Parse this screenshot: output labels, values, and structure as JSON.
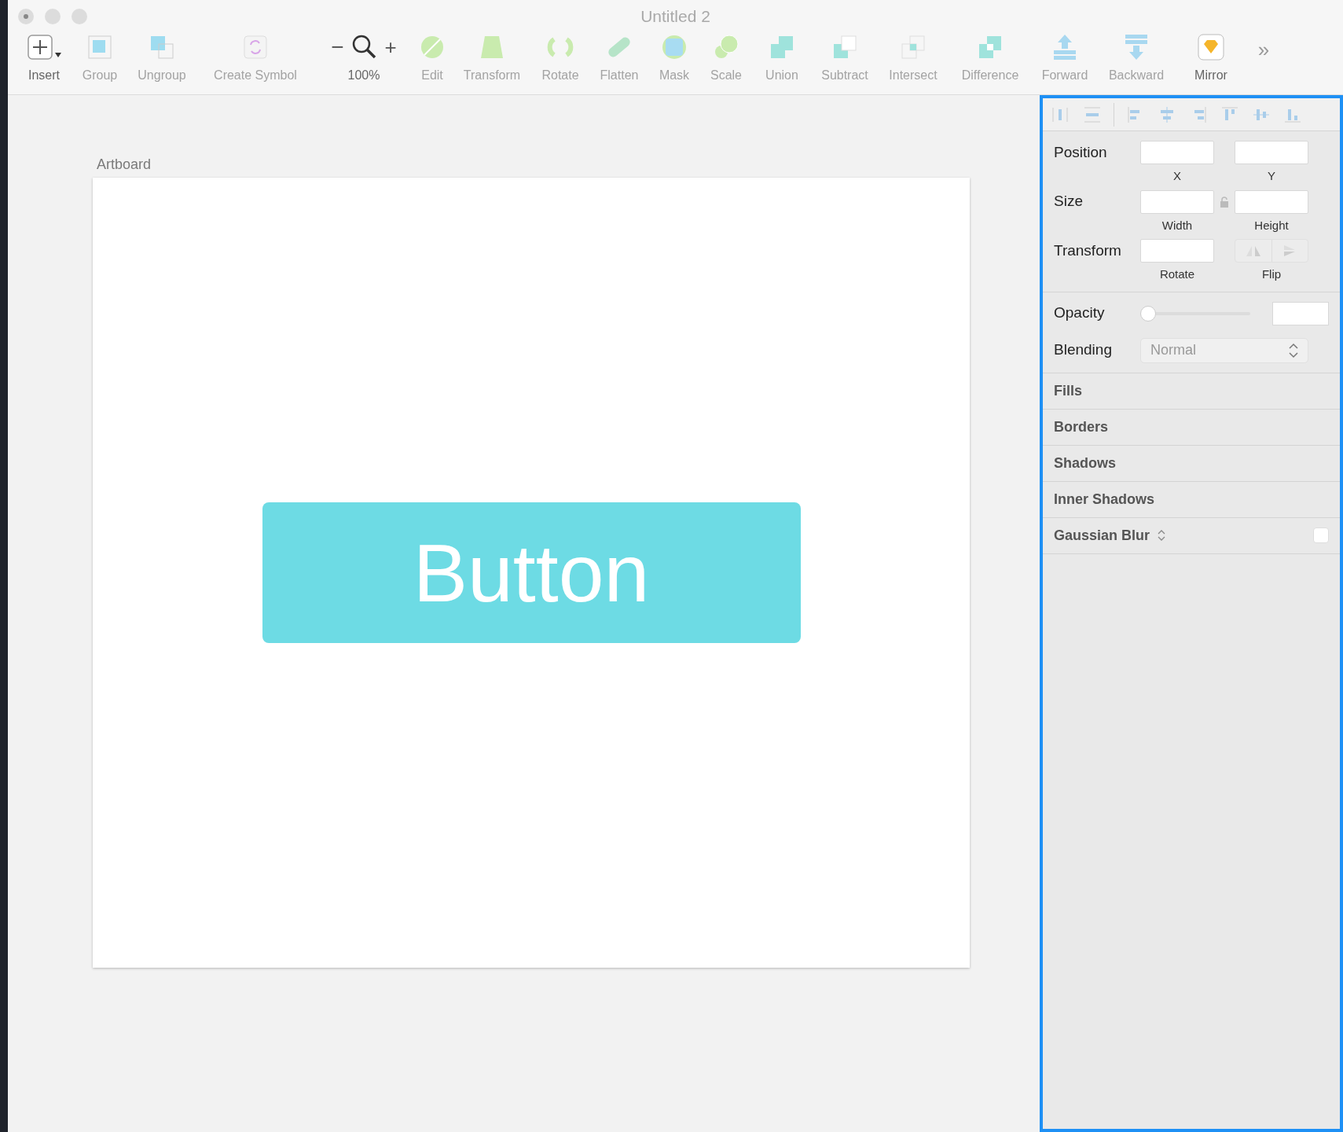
{
  "window": {
    "title": "Untitled 2"
  },
  "toolbar": [
    {
      "kind": "insert",
      "label": "Insert",
      "disabled": false
    },
    {
      "kind": "button",
      "label": "Group",
      "disabled": true
    },
    {
      "kind": "button",
      "label": "Ungroup",
      "disabled": true
    },
    {
      "kind": "button",
      "label": "Create Symbol",
      "disabled": true
    },
    {
      "kind": "zoom",
      "label": "100%",
      "minus": "−",
      "plus": "+"
    },
    {
      "kind": "button",
      "label": "Edit",
      "disabled": true
    },
    {
      "kind": "button",
      "label": "Transform",
      "disabled": true
    },
    {
      "kind": "button",
      "label": "Rotate",
      "disabled": true
    },
    {
      "kind": "button",
      "label": "Flatten",
      "disabled": true
    },
    {
      "kind": "button",
      "label": "Mask",
      "disabled": true
    },
    {
      "kind": "button",
      "label": "Scale",
      "disabled": true
    },
    {
      "kind": "button",
      "label": "Union",
      "disabled": true
    },
    {
      "kind": "button",
      "label": "Subtract",
      "disabled": true
    },
    {
      "kind": "button",
      "label": "Intersect",
      "disabled": true
    },
    {
      "kind": "button",
      "label": "Difference",
      "disabled": true
    },
    {
      "kind": "button",
      "label": "Forward",
      "disabled": true
    },
    {
      "kind": "button",
      "label": "Backward",
      "disabled": true
    },
    {
      "kind": "button",
      "label": "Mirror",
      "disabled": false
    },
    {
      "kind": "overflow",
      "label": "»"
    }
  ],
  "canvas": {
    "artboard_label": "Artboard",
    "button_text": "Button"
  },
  "inspector": {
    "rows": [
      {
        "label": "Position",
        "fields": [
          {
            "caption": "X"
          },
          {
            "caption": "Y"
          }
        ]
      },
      {
        "label": "Size",
        "lock": true,
        "fields": [
          {
            "caption": "Width"
          },
          {
            "caption": "Height"
          }
        ]
      },
      {
        "label": "Transform",
        "fields": [
          {
            "caption": "Rotate"
          }
        ],
        "flip": {
          "caption": "Flip"
        }
      }
    ],
    "opacity": {
      "label": "Opacity",
      "level": 0
    },
    "blending": {
      "label": "Blending",
      "value": "Normal"
    },
    "sections": [
      {
        "label": "Fills"
      },
      {
        "label": "Borders"
      },
      {
        "label": "Shadows"
      },
      {
        "label": "Inner Shadows"
      },
      {
        "label": "Gaussian Blur",
        "stepper": true,
        "checked": false
      }
    ]
  }
}
